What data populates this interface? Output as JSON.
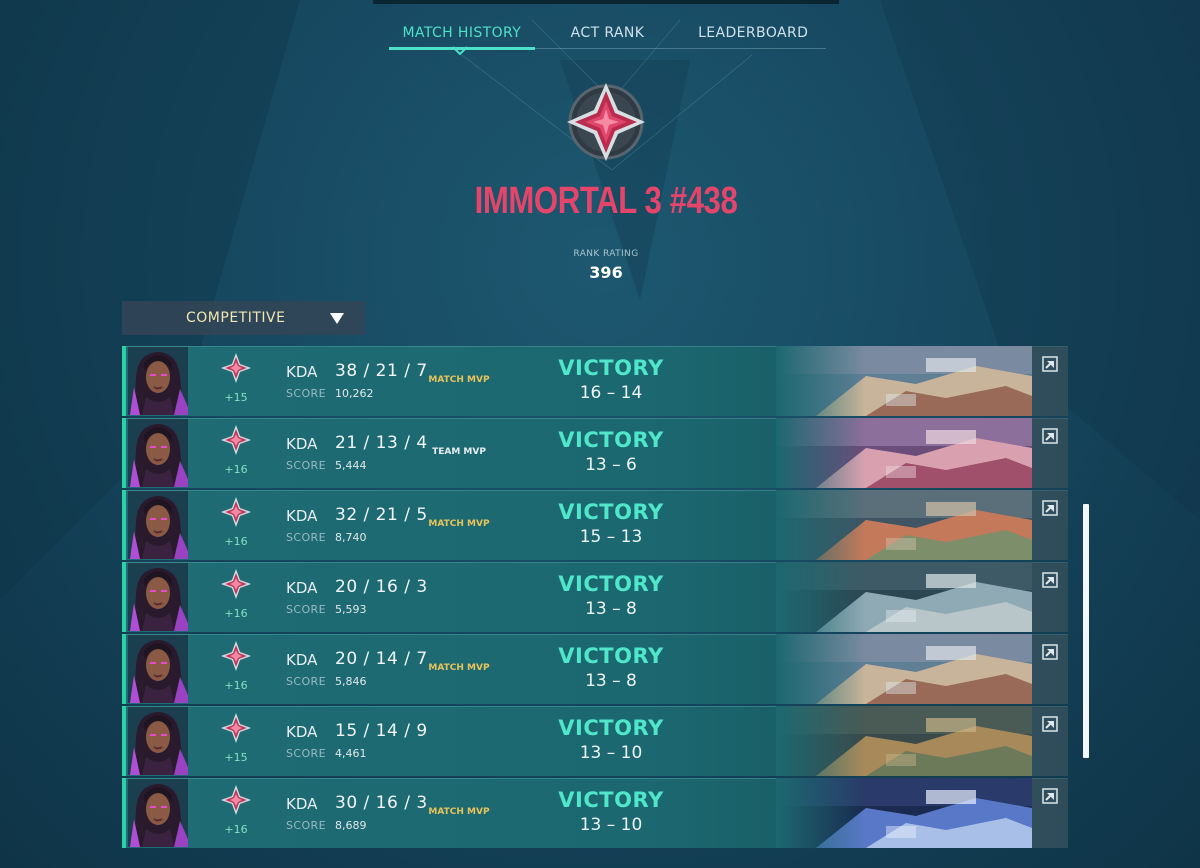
{
  "tabs": [
    {
      "label": "MATCH HISTORY",
      "active": true
    },
    {
      "label": "ACT RANK",
      "active": false
    },
    {
      "label": "LEADERBOARD",
      "active": false
    }
  ],
  "rank": {
    "title": "IMMORTAL 3 #438",
    "rating_label": "RANK RATING",
    "rating_value": "396",
    "color": "#e5456b"
  },
  "queue": {
    "selected": "COMPETITIVE"
  },
  "colors": {
    "accent": "#4fe0c9",
    "victory": "#4fe6c9",
    "mvp": "#e8c45a"
  },
  "matches": [
    {
      "rr": "+15",
      "kda_label": "KDA",
      "kda": "38 / 21 / 7",
      "score_label": "SCORE",
      "score": "10,262",
      "mvp": "MATCH MVP",
      "mvp_type": "match",
      "result": "VICTORY",
      "rounds": "16 – 14",
      "map": "a"
    },
    {
      "rr": "+16",
      "kda_label": "KDA",
      "kda": "21 / 13 / 4",
      "score_label": "SCORE",
      "score": "5,444",
      "mvp": "TEAM MVP",
      "mvp_type": "team",
      "result": "VICTORY",
      "rounds": "13 – 6",
      "map": "b"
    },
    {
      "rr": "+16",
      "kda_label": "KDA",
      "kda": "32 / 21 / 5",
      "score_label": "SCORE",
      "score": "8,740",
      "mvp": "MATCH MVP",
      "mvp_type": "match",
      "result": "VICTORY",
      "rounds": "15 – 13",
      "map": "c"
    },
    {
      "rr": "+16",
      "kda_label": "KDA",
      "kda": "20 / 16 / 3",
      "score_label": "SCORE",
      "score": "5,593",
      "mvp": "",
      "mvp_type": "none",
      "result": "VICTORY",
      "rounds": "13 – 8",
      "map": "d"
    },
    {
      "rr": "+16",
      "kda_label": "KDA",
      "kda": "20 / 14 / 7",
      "score_label": "SCORE",
      "score": "5,846",
      "mvp": "MATCH MVP",
      "mvp_type": "match",
      "result": "VICTORY",
      "rounds": "13 – 8",
      "map": "a"
    },
    {
      "rr": "+15",
      "kda_label": "KDA",
      "kda": "15 / 14 / 9",
      "score_label": "SCORE",
      "score": "4,461",
      "mvp": "",
      "mvp_type": "none",
      "result": "VICTORY",
      "rounds": "13 – 10",
      "map": "e"
    },
    {
      "rr": "+16",
      "kda_label": "KDA",
      "kda": "30 / 16 / 3",
      "score_label": "SCORE",
      "score": "8,689",
      "mvp": "MATCH MVP",
      "mvp_type": "match",
      "result": "VICTORY",
      "rounds": "13 – 10",
      "map": "f"
    }
  ]
}
